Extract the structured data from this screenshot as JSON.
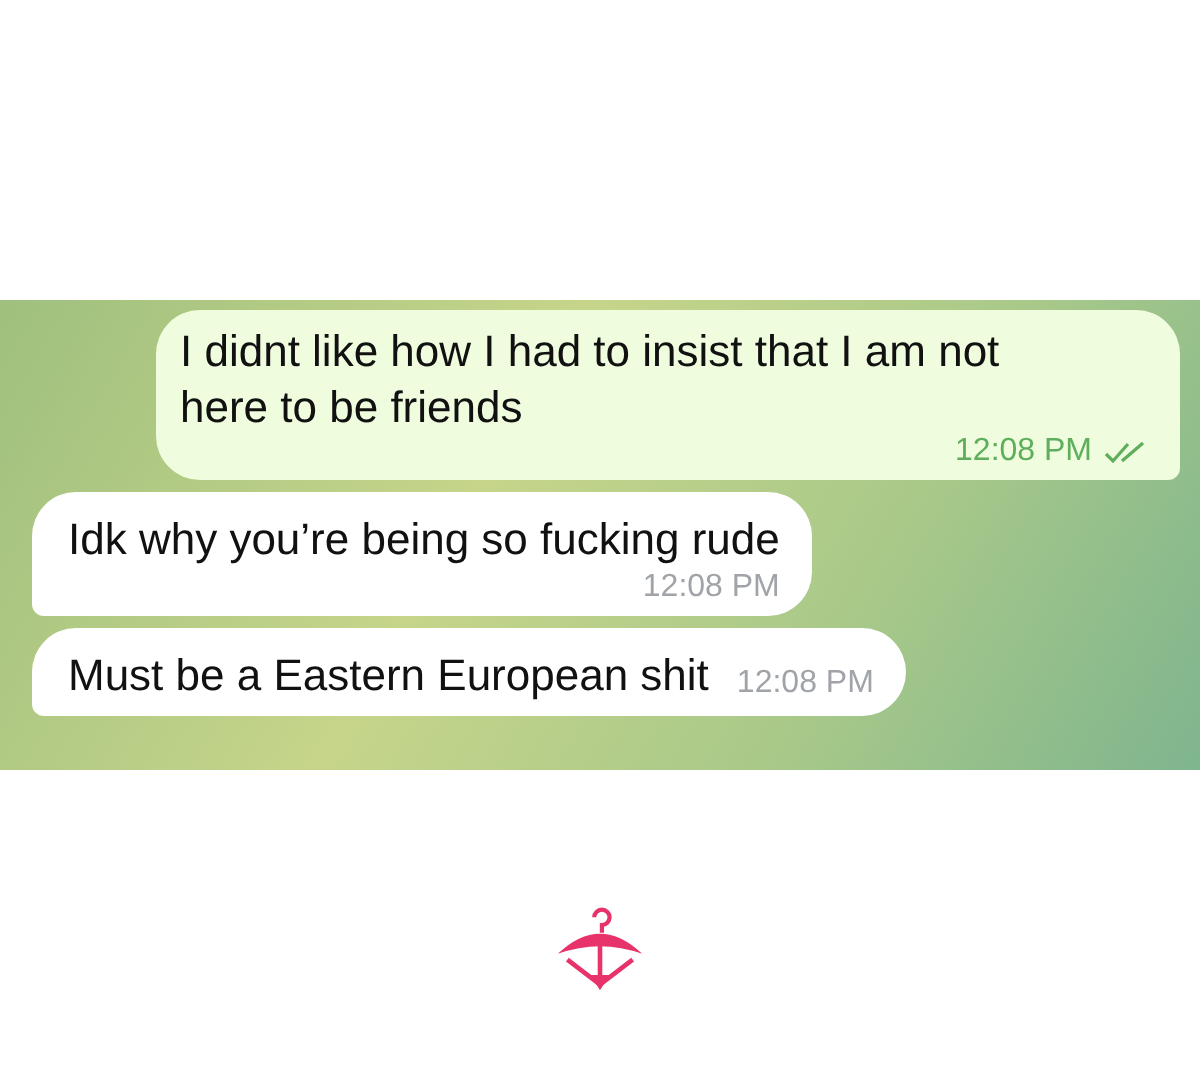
{
  "messages": [
    {
      "kind": "outgoing",
      "text": "I didnt like how I had to insist that I am not here to be friends",
      "time": "12:08 PM",
      "read": true
    },
    {
      "kind": "incoming",
      "text": "Idk why you’re being so fucking rude",
      "time": "12:08 PM"
    },
    {
      "kind": "incoming",
      "text": "Must be a Eastern European shit",
      "time": "12:08 PM"
    }
  ]
}
